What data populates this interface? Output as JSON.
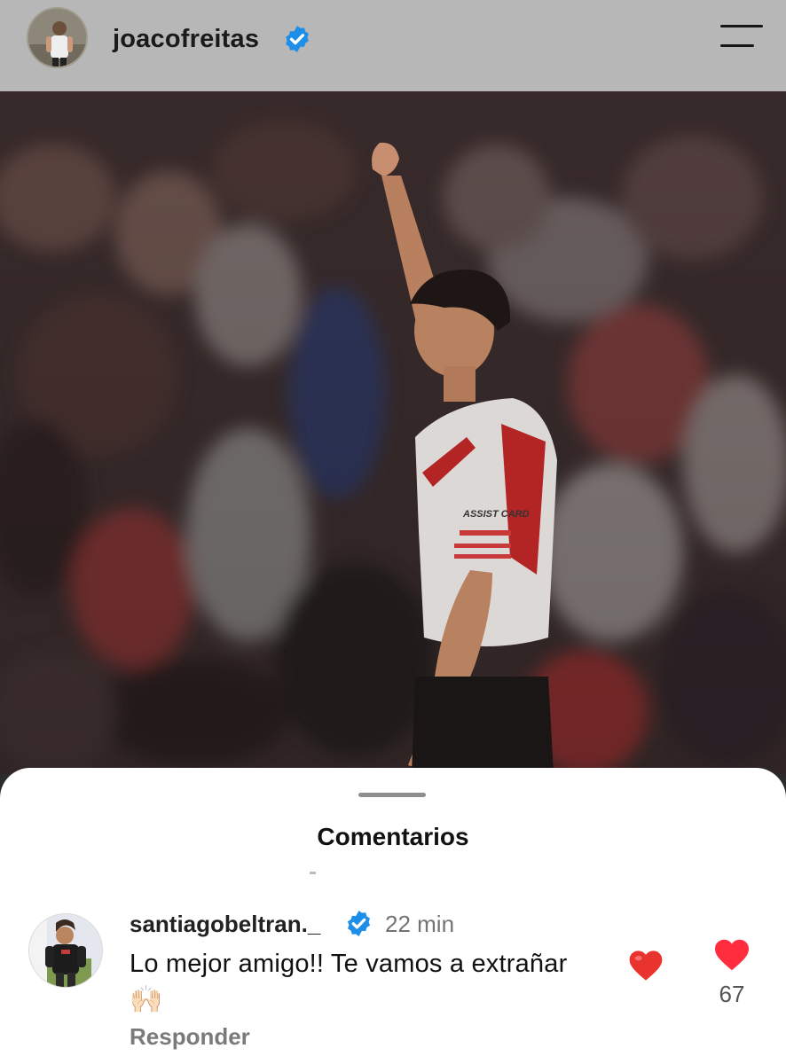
{
  "header": {
    "username": "joacofreitas",
    "avatar_icon": "profile-photo",
    "verified_icon": "verified-badge-icon",
    "menu_icon": "hamburger-menu-icon"
  },
  "post": {
    "image_icon": "post-photo",
    "jersey_text": "ASSIST CARD"
  },
  "comments_sheet": {
    "title": "Comentarios",
    "comment": {
      "username": "santiagobeltran._",
      "time": "22 min",
      "text": "Lo mejor amigo!! Te vamos a extrañar",
      "text_emoji": "❤️",
      "second_line_emoji": "🙌🏻",
      "reply_label": "Responder",
      "like_count": "67",
      "like_icon": "heart-icon"
    }
  },
  "colors": {
    "header_bg": "#b7b7b7",
    "verified_blue": "#1d8fe8",
    "like_red": "#ff2d3d",
    "sheet_bg": "#ffffff"
  }
}
